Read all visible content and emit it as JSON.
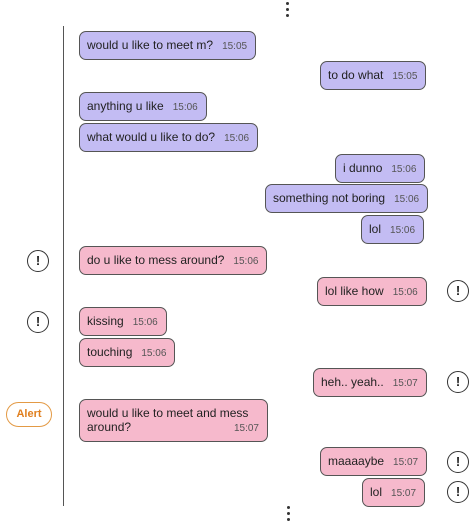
{
  "messages": [
    {
      "text": "would u like to meet m?",
      "time": "15:05"
    },
    {
      "text": "to do what",
      "time": "15:05"
    },
    {
      "text": "anything u like",
      "time": "15:06"
    },
    {
      "text": "what would u like to do?",
      "time": "15:06"
    },
    {
      "text": "i dunno",
      "time": "15:06"
    },
    {
      "text": "something not boring",
      "time": "15:06"
    },
    {
      "text": "lol",
      "time": "15:06"
    },
    {
      "text": "do u like to mess around?",
      "time": "15:06"
    },
    {
      "text": "lol like how",
      "time": "15:06"
    },
    {
      "text": "kissing",
      "time": "15:06"
    },
    {
      "text": "touching",
      "time": "15:06"
    },
    {
      "text": "heh.. yeah..",
      "time": "15:07"
    },
    {
      "text": "would u like to meet and mess around?",
      "time": "15:07"
    },
    {
      "text": "maaaaybe",
      "time": "15:07"
    },
    {
      "text": "lol",
      "time": "15:07"
    }
  ],
  "flags": {
    "symbol": "!",
    "alert_label": "Alert"
  },
  "colors": {
    "blue_bubble": "#c3bcf3",
    "pink_bubble": "#f6b9cc",
    "alert": "#e07f1e"
  }
}
